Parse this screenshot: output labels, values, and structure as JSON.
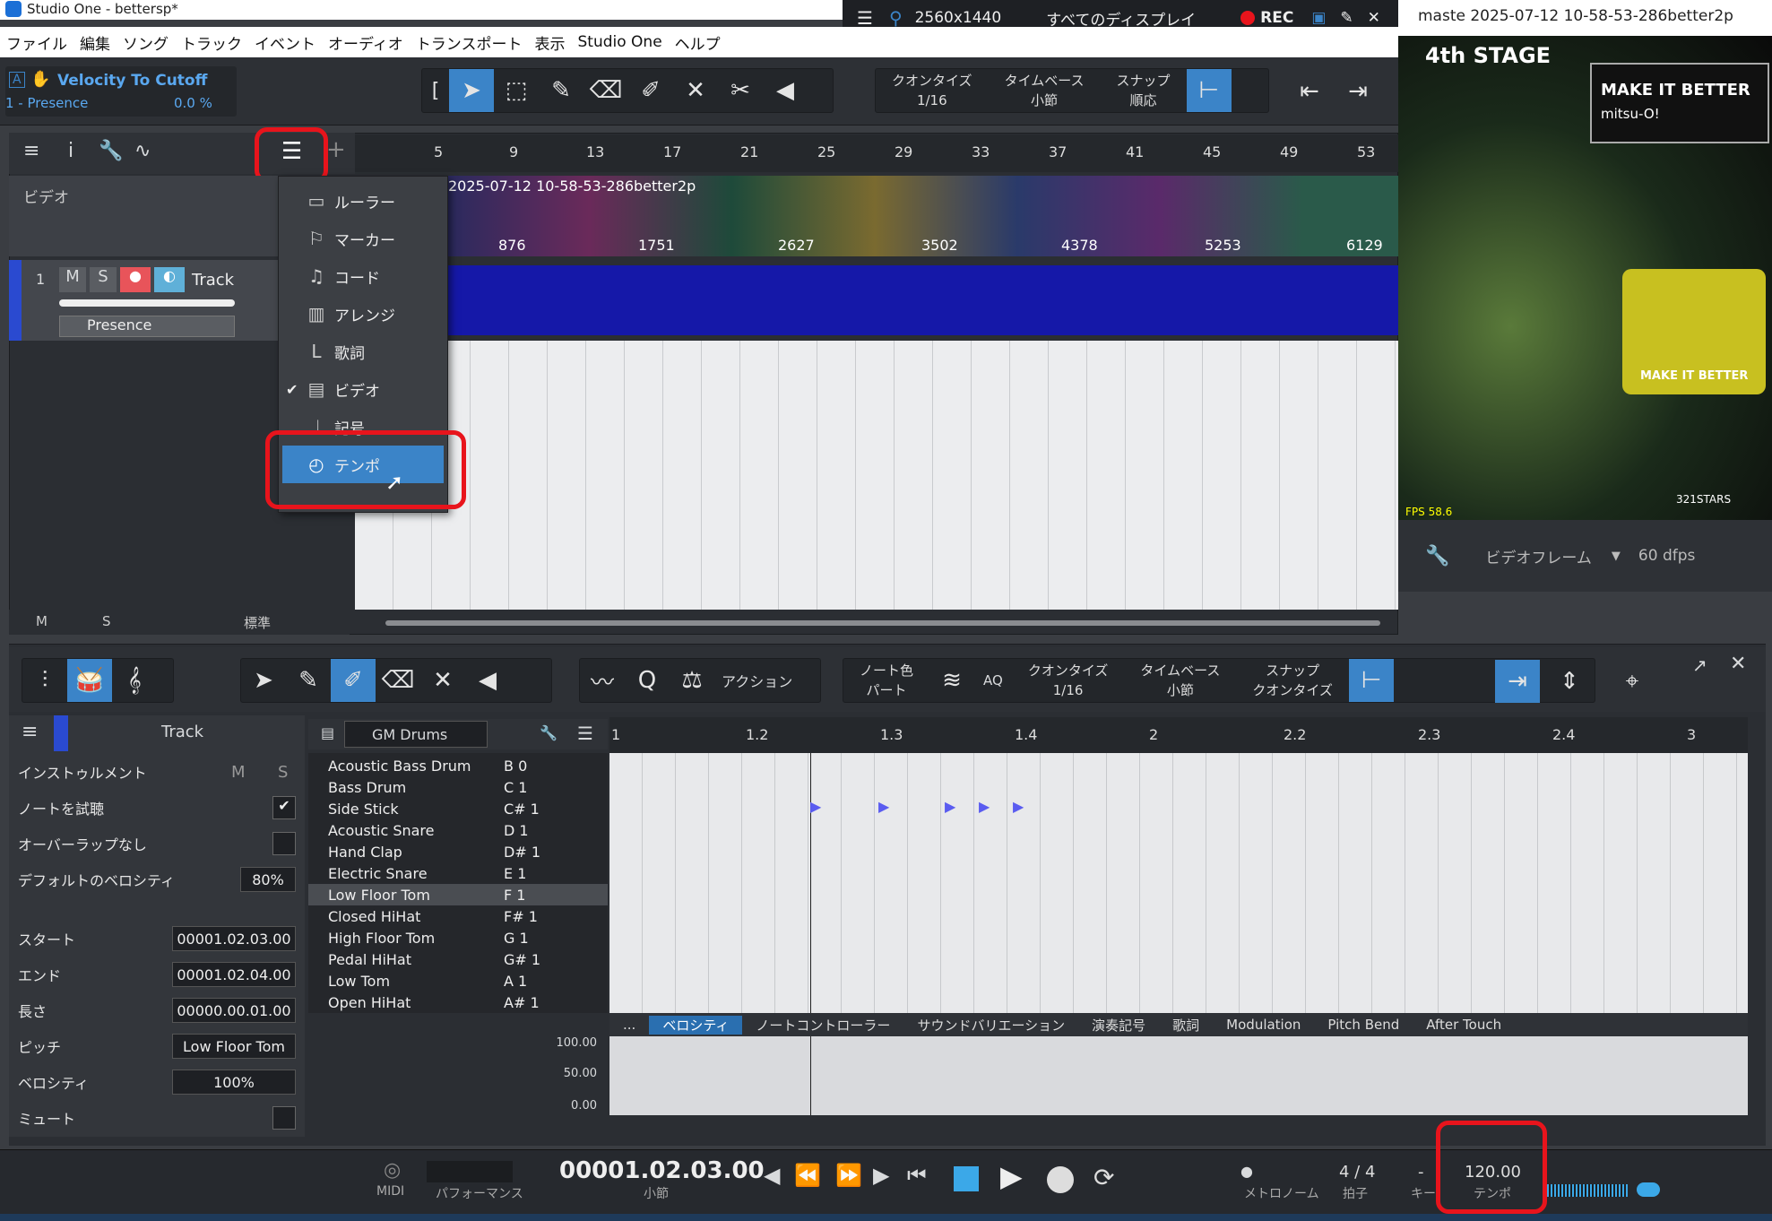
{
  "window": {
    "app_icon": "studio-one-icon",
    "title": "Studio One - bettersp*"
  },
  "recorder": {
    "resolution": "2560x1440",
    "display": "すべてのディスプレイ",
    "rec": "REC",
    "filename": "maste 2025-07-12 10-58-53-286better2p"
  },
  "menu": [
    "ファイル",
    "編集",
    "ソング",
    "トラック",
    "イベント",
    "オーディオ",
    "トランスポート",
    "表示",
    "Studio One",
    "ヘルプ"
  ],
  "toolbar": {
    "macro_title": "Velocity To Cutoff",
    "macro_sub": "1 - Presence",
    "macro_value": "0.0 %",
    "quantize_label": "クオンタイズ",
    "quantize_value": "1/16",
    "timebase_label": "タイムベース",
    "timebase_value": "小節",
    "snap_label": "スナップ",
    "snap_value": "順応"
  },
  "ruler": {
    "ticks": [
      "5",
      "9",
      "13",
      "17",
      "21",
      "25",
      "29",
      "33",
      "37",
      "41",
      "45",
      "49",
      "53"
    ]
  },
  "video_track": {
    "label": "ビデオ",
    "clip_name": "2025-07-12 10-58-53-286better2p",
    "frames": [
      "876",
      "1751",
      "2627",
      "3502",
      "4378",
      "5253",
      "6129"
    ]
  },
  "track": {
    "number": "1",
    "mute": "M",
    "solo": "S",
    "name": "Track",
    "instrument": "Presence"
  },
  "arranger_footer": {
    "m": "M",
    "s": "S",
    "mode": "標準"
  },
  "popup_menu": {
    "items": [
      {
        "label": "ルーラー",
        "icon": "ruler-icon",
        "checked": false
      },
      {
        "label": "マーカー",
        "icon": "marker-flag-icon",
        "checked": false
      },
      {
        "label": "コード",
        "icon": "chord-icon",
        "checked": false
      },
      {
        "label": "アレンジ",
        "icon": "arrange-icon",
        "checked": false
      },
      {
        "label": "歌詞",
        "icon": "lyrics-icon",
        "checked": false
      },
      {
        "label": "ビデオ",
        "icon": "video-icon",
        "checked": true
      },
      {
        "label": "記号",
        "icon": "signature-icon",
        "checked": false
      },
      {
        "label": "テンポ",
        "icon": "tempo-icon",
        "checked": false,
        "selected": true
      }
    ]
  },
  "preview": {
    "stage": "4th STAGE",
    "info_title": "MAKE IT BETTER",
    "info_artist": "mitsu-O!",
    "song_card": "MAKE IT BETTER",
    "fps": "FPS 58.6",
    "stars": "321STARS",
    "frame_label": "ビデオフレーム",
    "fps_value": "60 dfps"
  },
  "editor": {
    "action_label": "アクション",
    "note_color_label": "ノート色",
    "note_color_value": "パート",
    "aq": "AQ",
    "quantize_label": "クオンタイズ",
    "quantize_value": "1/16",
    "timebase_label": "タイムベース",
    "timebase_value": "小節",
    "snap_label": "スナップ",
    "snap_value": "クオンタイズ",
    "track_name": "Track",
    "drum_map": "GM Drums",
    "ruler_ticks": [
      "1",
      "1.2",
      "1.3",
      "1.4",
      "2",
      "2.2",
      "2.3",
      "2.4",
      "3"
    ]
  },
  "inspector": {
    "instrument_label": "インストゥルメント",
    "m": "M",
    "s": "S",
    "audition_label": "ノートを試聴",
    "no_overlap_label": "オーバーラップなし",
    "default_velocity_label": "デフォルトのベロシティ",
    "default_velocity": "80%",
    "start_label": "スタート",
    "start": "00001.02.03.00",
    "end_label": "エンド",
    "end": "00001.02.04.00",
    "length_label": "長さ",
    "length": "00000.00.01.00",
    "pitch_label": "ピッチ",
    "pitch": "Low Floor Tom",
    "velocity_label": "ベロシティ",
    "velocity": "100%",
    "mute_label": "ミュート"
  },
  "drums": [
    {
      "name": "Acoustic Bass Drum",
      "key": "B 0"
    },
    {
      "name": "Bass Drum",
      "key": "C 1"
    },
    {
      "name": "Side Stick",
      "key": "C# 1"
    },
    {
      "name": "Acoustic Snare",
      "key": "D 1"
    },
    {
      "name": "Hand Clap",
      "key": "D# 1"
    },
    {
      "name": "Electric Snare",
      "key": "E 1"
    },
    {
      "name": "Low Floor Tom",
      "key": "F 1"
    },
    {
      "name": "Closed HiHat",
      "key": "F# 1"
    },
    {
      "name": "High Floor Tom",
      "key": "G 1"
    },
    {
      "name": "Pedal HiHat",
      "key": "G# 1"
    },
    {
      "name": "Low Tom",
      "key": "A 1"
    },
    {
      "name": "Open HiHat",
      "key": "A# 1"
    }
  ],
  "velocity_lane": {
    "tabs": [
      "...",
      "ベロシティ",
      "ノートコントローラー",
      "サウンドバリエーション",
      "演奏記号",
      "歌詞",
      "Modulation",
      "Pitch Bend",
      "After Touch"
    ],
    "scale": [
      "100.00",
      "50.00",
      "0.00"
    ]
  },
  "transport": {
    "midi": "MIDI",
    "performance": "パフォーマンス",
    "position": "00001.02.03.00",
    "position_unit": "小節",
    "metronome": "メトロノーム",
    "time_sig": "4 / 4",
    "time_sig_label": "拍子",
    "key_value": "-",
    "key_label": "キー",
    "tempo": "120.00",
    "tempo_label": "テンポ"
  },
  "colors": {
    "accent": "#3b84c8",
    "highlight_red": "#e8141c",
    "track_lane": "#1518a8",
    "note": "#5a5cf0"
  }
}
